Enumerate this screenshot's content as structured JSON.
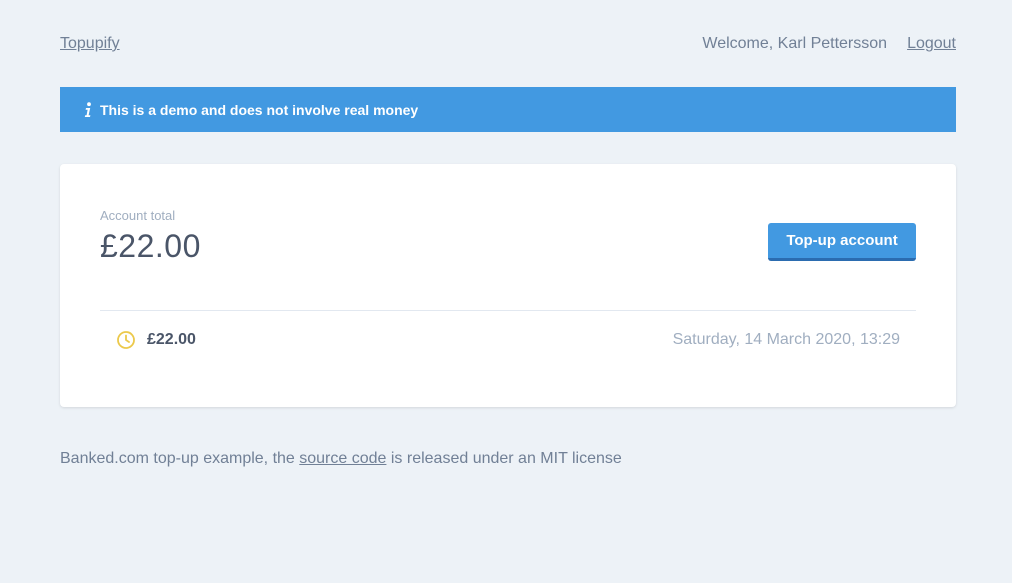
{
  "header": {
    "brand": "Topupify",
    "welcome": "Welcome, Karl Pettersson",
    "logout": "Logout"
  },
  "notice": {
    "icon": "info-icon",
    "text": "This is a demo and does not involve real money",
    "color": "#4299e1"
  },
  "account": {
    "label": "Account total",
    "total": "£22.00",
    "topup_button": "Top-up account"
  },
  "transactions": [
    {
      "status_icon": "clock-icon",
      "status_color": "#ecc94b",
      "amount": "£22.00",
      "date": "Saturday, 14 March 2020, 13:29"
    }
  ],
  "footer": {
    "prefix": "Banked.com top-up example, the ",
    "link": "source code",
    "suffix": " is released under an MIT license"
  }
}
